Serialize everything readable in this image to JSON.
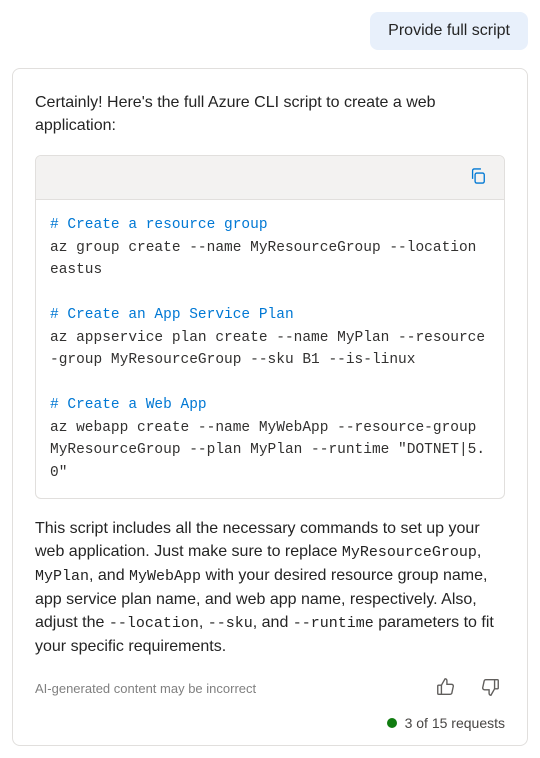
{
  "user_message": "Provide full script",
  "assistant": {
    "intro": "Certainly! Here's the full Azure CLI script to create a web application:",
    "code": {
      "lines": [
        {
          "t": "comment",
          "v": "# Create a resource group"
        },
        {
          "t": "cmd",
          "v": "az group create --name MyResourceGroup --location eastus"
        },
        {
          "t": "blank",
          "v": ""
        },
        {
          "t": "comment",
          "v": "# Create an App Service Plan"
        },
        {
          "t": "cmd",
          "v": "az appservice plan create --name MyPlan --resource-group MyResourceGroup --sku B1 --is-linux"
        },
        {
          "t": "blank",
          "v": ""
        },
        {
          "t": "comment",
          "v": "# Create a Web App"
        },
        {
          "t": "cmd",
          "v": "az webapp create --name MyWebApp --resource-group MyResourceGroup --plan MyPlan --runtime \"DOTNET|5.0\""
        }
      ]
    },
    "outro_parts": [
      {
        "t": "text",
        "v": "This script includes all the necessary commands to set up your web application. Just make sure to replace "
      },
      {
        "t": "code",
        "v": "MyResourceGroup"
      },
      {
        "t": "text",
        "v": ", "
      },
      {
        "t": "code",
        "v": "MyPlan"
      },
      {
        "t": "text",
        "v": ", and "
      },
      {
        "t": "code",
        "v": "MyWebApp"
      },
      {
        "t": "text",
        "v": " with your desired resource group name, app service plan name, and web app name, respectively. Also, adjust the "
      },
      {
        "t": "code",
        "v": "--location"
      },
      {
        "t": "text",
        "v": ", "
      },
      {
        "t": "code",
        "v": "--sku"
      },
      {
        "t": "text",
        "v": ", and "
      },
      {
        "t": "code",
        "v": "--runtime"
      },
      {
        "t": "text",
        "v": " parameters to fit your specific requirements."
      }
    ],
    "disclaimer": "AI-generated content may be incorrect"
  },
  "requests": {
    "used": 3,
    "total": 15,
    "label": "3 of 15 requests"
  },
  "icons": {
    "copy": "copy-icon",
    "thumbs_up": "thumbs-up-icon",
    "thumbs_down": "thumbs-down-icon"
  },
  "colors": {
    "accent": "#0078d4",
    "status_ok": "#107c10",
    "user_bubble": "#e8f0fb"
  }
}
